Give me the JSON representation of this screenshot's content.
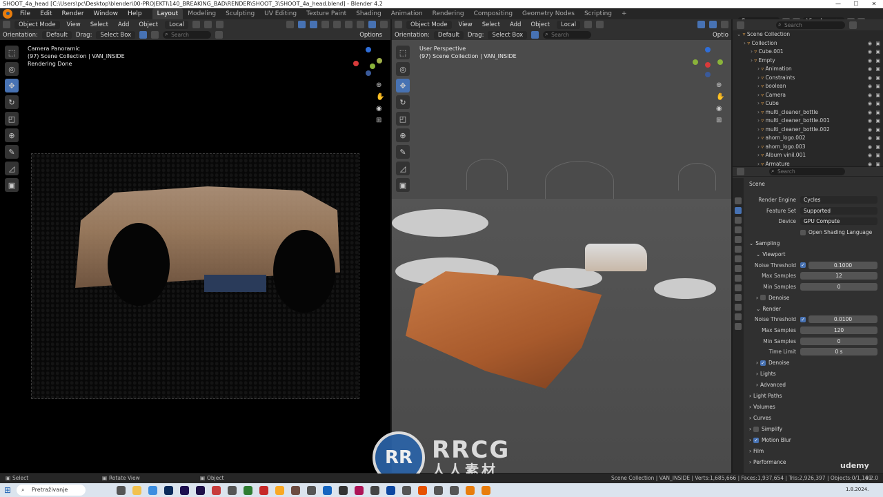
{
  "title_bar": {
    "text": "SHOOT_4a_head [C:\\Users\\pc\\Desktop\\blender\\00-PROJEKTI\\140_BREAKING_BAD\\RENDER\\SHOOT_3\\SHOOT_4a_head.blend] - Blender 4.2"
  },
  "menu": {
    "items": [
      "File",
      "Edit",
      "Render",
      "Window",
      "Help"
    ],
    "workspaces": [
      "Layout",
      "Modeling",
      "Sculpting",
      "UV Editing",
      "Texture Paint",
      "Shading",
      "Animation",
      "Rendering",
      "Compositing",
      "Geometry Nodes",
      "Scripting"
    ],
    "add": "+",
    "scene": "Scene",
    "view_layer": "ViewLayer"
  },
  "left_viewport": {
    "mode": "Object Mode",
    "view": "View",
    "select": "Select",
    "add": "Add",
    "object": "Object",
    "transform": "Local",
    "orientation_label": "Orientation:",
    "orientation_value": "Default",
    "drag_label": "Drag:",
    "drag_value": "Select Box",
    "options": "Options",
    "search_placeholder": "Search",
    "overlay_line1": "Camera Panoramic",
    "overlay_line2": "(97) Scene Collection | VAN_INSIDE",
    "overlay_line3": "Rendering Done"
  },
  "right_viewport": {
    "mode": "Object Mode",
    "view": "View",
    "select": "Select",
    "add": "Add",
    "object": "Object",
    "transform": "Local",
    "orientation_label": "Orientation:",
    "orientation_value": "Default",
    "drag_label": "Drag:",
    "drag_value": "Select Box",
    "options": "Optio",
    "search_placeholder": "Search",
    "overlay_line1": "User Perspective",
    "overlay_line2": "(97) Scene Collection | VAN_INSIDE"
  },
  "outliner": {
    "search_placeholder": "Search",
    "rows": [
      {
        "label": "Scene Collection",
        "indent": 0
      },
      {
        "label": "Collection",
        "indent": 1
      },
      {
        "label": "Cube.001",
        "indent": 2
      },
      {
        "label": "Empty",
        "indent": 2
      },
      {
        "label": "Animation",
        "indent": 3
      },
      {
        "label": "Constraints",
        "indent": 3
      },
      {
        "label": "boolean",
        "indent": 3
      },
      {
        "label": "Camera",
        "indent": 3
      },
      {
        "label": "Cube",
        "indent": 3
      },
      {
        "label": "multi_cleaner_bottle",
        "indent": 3
      },
      {
        "label": "multi_cleaner_bottle.001",
        "indent": 3
      },
      {
        "label": "multi_cleaner_bottle.002",
        "indent": 3
      },
      {
        "label": "ahorn_logo.002",
        "indent": 3
      },
      {
        "label": "ahorn_logo.003",
        "indent": 3
      },
      {
        "label": "Album vinil.001",
        "indent": 3
      },
      {
        "label": "Armature",
        "indent": 3
      }
    ]
  },
  "properties": {
    "search_placeholder": "Search",
    "context": "Scene",
    "render_engine_label": "Render Engine",
    "render_engine": "Cycles",
    "feature_set_label": "Feature Set",
    "feature_set": "Supported",
    "device_label": "Device",
    "device": "GPU Compute",
    "osl": "Open Shading Language",
    "sampling": "Sampling",
    "viewport": "Viewport",
    "noise_threshold_label": "Noise Threshold",
    "vp_noise_threshold": "0.1000",
    "max_samples_label": "Max Samples",
    "vp_max_samples": "12",
    "min_samples_label": "Min Samples",
    "vp_min_samples": "0",
    "denoise": "Denoise",
    "render": "Render",
    "r_noise_threshold": "0.0100",
    "r_max_samples": "120",
    "r_min_samples": "0",
    "time_limit_label": "Time Limit",
    "r_time_limit": "0 s",
    "lights": "Lights",
    "advanced": "Advanced",
    "light_paths": "Light Paths",
    "volumes": "Volumes",
    "curves": "Curves",
    "simplify": "Simplify",
    "motion_blur": "Motion Blur",
    "film": "Film",
    "performance": "Performance"
  },
  "status": {
    "select": "Select",
    "rotate": "Rotate View",
    "object": "Object",
    "stats": "Scene Collection | VAN_INSIDE | Verts:1,685,666 | Faces:1,937,654 | Tris:2,926,397 | Objects:0/1,169",
    "version": "4.2.0"
  },
  "taskbar": {
    "search": "Pretraživanje",
    "date": "1.8.2024."
  },
  "watermark": {
    "big": "RRCG",
    "small": "人人素材",
    "badge": "RR",
    "udemy": "udemy"
  },
  "colors": {
    "accent": "#4772b3",
    "orange": "#e87d0d",
    "bg": "#303030"
  }
}
